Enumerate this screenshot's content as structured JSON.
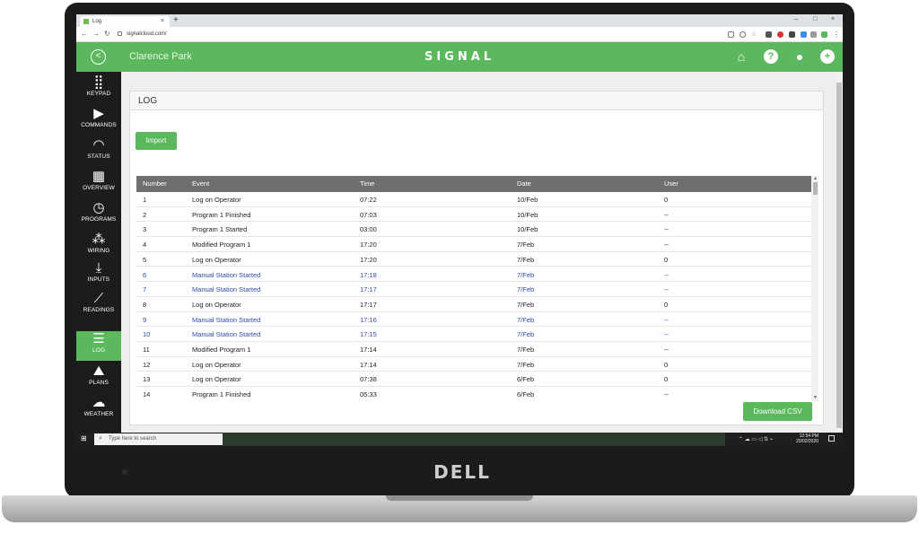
{
  "browser": {
    "tab_title": "Log",
    "url": "signalcloud.com/",
    "new_tab": "+",
    "tab_close": "×",
    "window_controls": [
      "–",
      "□",
      "×"
    ]
  },
  "header": {
    "site_name": "Clarence Park",
    "logo": "SIGNAL",
    "icons": [
      "home-icon",
      "help-icon",
      "user-icon",
      "add-icon"
    ]
  },
  "sidebar": {
    "items": [
      {
        "label": "KEYPAD",
        "icon": "keypad-icon"
      },
      {
        "label": "COMMANDS",
        "icon": "play-icon"
      },
      {
        "label": "STATUS",
        "icon": "gauge-icon"
      },
      {
        "label": "OVERVIEW",
        "icon": "calendar-icon"
      },
      {
        "label": "PROGRAMS",
        "icon": "clock-icon"
      },
      {
        "label": "WIRING",
        "icon": "grid-icon"
      },
      {
        "label": "INPUTS",
        "icon": "download-icon"
      },
      {
        "label": "READINGS",
        "icon": "chart-icon"
      },
      {
        "label": "LOG",
        "icon": "list-icon"
      },
      {
        "label": "PLANS",
        "icon": "map-icon"
      },
      {
        "label": "WEATHER",
        "icon": "weather-icon"
      }
    ],
    "active": "LOG"
  },
  "panel": {
    "title": "LOG",
    "import_label": "Import",
    "download_label": "Download CSV"
  },
  "table": {
    "columns": [
      "Number",
      "Event",
      "Time",
      "Date",
      "User"
    ],
    "rows": [
      {
        "number": "1",
        "event": "Log on Operator",
        "time": "07:22",
        "date": "10/Feb",
        "user": "0",
        "link": false
      },
      {
        "number": "2",
        "event": "Program 1 Finished",
        "time": "07:03",
        "date": "10/Feb",
        "user": "--",
        "link": false
      },
      {
        "number": "3",
        "event": "Program 1 Started",
        "time": "03:00",
        "date": "10/Feb",
        "user": "--",
        "link": false
      },
      {
        "number": "4",
        "event": "Modified Program 1",
        "time": "17:20",
        "date": "7/Feb",
        "user": "--",
        "link": false
      },
      {
        "number": "5",
        "event": "Log on Operator",
        "time": "17:20",
        "date": "7/Feb",
        "user": "0",
        "link": false
      },
      {
        "number": "6",
        "event": "Manual Station Started",
        "time": "17:18",
        "date": "7/Feb",
        "user": "--",
        "link": true
      },
      {
        "number": "7",
        "event": "Manual Station Started",
        "time": "17:17",
        "date": "7/Feb",
        "user": "--",
        "link": true
      },
      {
        "number": "8",
        "event": "Log on Operator",
        "time": "17:17",
        "date": "7/Feb",
        "user": "0",
        "link": false
      },
      {
        "number": "9",
        "event": "Manual Station Started",
        "time": "17:16",
        "date": "7/Feb",
        "user": "--",
        "link": true
      },
      {
        "number": "10",
        "event": "Manual Station Started",
        "time": "17:15",
        "date": "7/Feb",
        "user": "--",
        "link": true
      },
      {
        "number": "11",
        "event": "Modified Program 1",
        "time": "17:14",
        "date": "7/Feb",
        "user": "--",
        "link": false
      },
      {
        "number": "12",
        "event": "Log on Operator",
        "time": "17:14",
        "date": "7/Feb",
        "user": "0",
        "link": false
      },
      {
        "number": "13",
        "event": "Log on Operator",
        "time": "07:38",
        "date": "6/Feb",
        "user": "0",
        "link": false
      },
      {
        "number": "14",
        "event": "Program 1 Finished",
        "time": "05:33",
        "date": "6/Feb",
        "user": "--",
        "link": false
      }
    ]
  },
  "taskbar": {
    "search_placeholder": "Type here to search",
    "time": "12:54 PM",
    "date": "20/02/2020"
  },
  "device": {
    "brand": "DELL"
  },
  "colors": {
    "accent": "#5cb85c",
    "sidebar": "#1c1c1c",
    "link": "#2f49a8",
    "table_header": "#6e6e6e"
  }
}
